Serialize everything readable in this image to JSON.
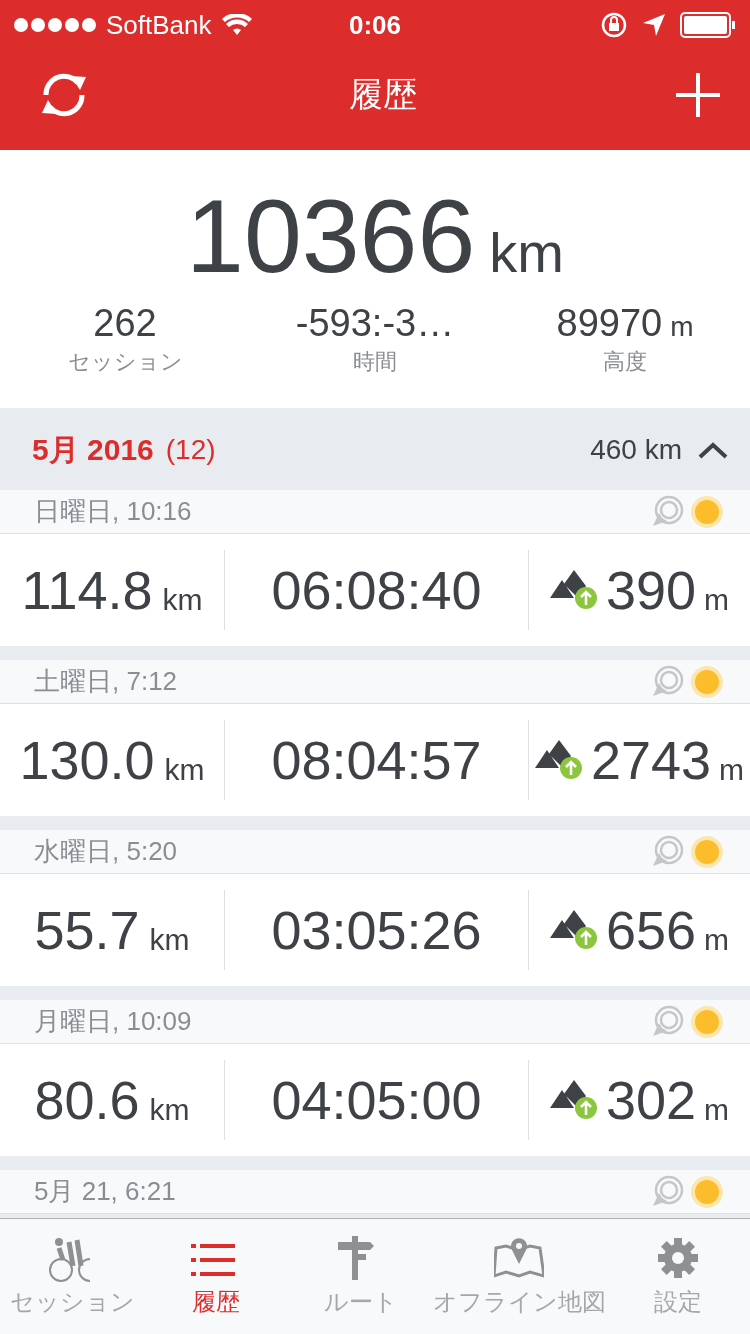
{
  "status_bar": {
    "carrier": "SoftBank",
    "time": "0:06"
  },
  "nav": {
    "title": "履歴"
  },
  "summary": {
    "distance": "10366",
    "unit": "km",
    "stats": [
      {
        "value": "262",
        "label": "セッション"
      },
      {
        "value": "-593:-3…",
        "label": "時間"
      },
      {
        "value": "89970",
        "unit": "m",
        "label": "高度"
      }
    ]
  },
  "month": {
    "title": "5月 2016",
    "count": "(12)",
    "distance": "460 km",
    "expanded": true
  },
  "sessions": [
    {
      "date": "日曜日, 10:16",
      "distance": "114.8",
      "distance_unit": "km",
      "duration": "06:08:40",
      "ascent": "390",
      "ascent_unit": "m"
    },
    {
      "date": "土曜日, 7:12",
      "distance": "130.0",
      "distance_unit": "km",
      "duration": "08:04:57",
      "ascent": "2743",
      "ascent_unit": "m"
    },
    {
      "date": "水曜日, 5:20",
      "distance": "55.7",
      "distance_unit": "km",
      "duration": "03:05:26",
      "ascent": "656",
      "ascent_unit": "m"
    },
    {
      "date": "月曜日, 10:09",
      "distance": "80.6",
      "distance_unit": "km",
      "duration": "04:05:00",
      "ascent": "302",
      "ascent_unit": "m"
    },
    {
      "date": "5月 21, 6:21"
    }
  ],
  "tabs": [
    {
      "kind": "bike",
      "label": "セッション",
      "selected": false
    },
    {
      "kind": "list",
      "label": "履歴",
      "selected": true
    },
    {
      "kind": "signpost",
      "label": "ルート",
      "selected": false
    },
    {
      "kind": "map",
      "label": "オフライン地図",
      "selected": false
    },
    {
      "kind": "gear",
      "label": "設定",
      "selected": false
    }
  ]
}
